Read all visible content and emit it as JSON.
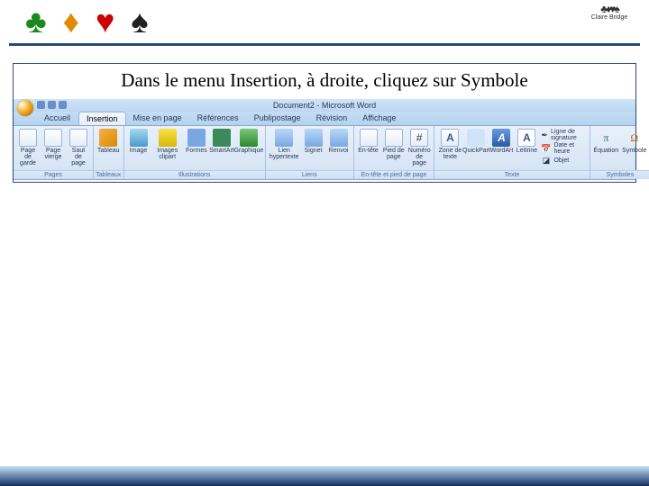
{
  "brand": {
    "suits": [
      "♣",
      "♦",
      "♥",
      "♠"
    ],
    "logo_suits": "♣♦♥♠",
    "logo_text": "Claire Bridge"
  },
  "instruction": "Dans le menu Insertion, à droite, cliquez sur Symbole",
  "word": {
    "title": "Document2 - Microsoft Word",
    "tabs": [
      "Accueil",
      "Insertion",
      "Mise en page",
      "Références",
      "Publipostage",
      "Révision",
      "Affichage"
    ],
    "active_tab_index": 1,
    "groups": {
      "pages": {
        "label": "Pages",
        "cover": "Page de garde",
        "blank": "Page vierge",
        "break": "Saut de page"
      },
      "tables": {
        "label": "Tableaux",
        "table": "Tableau"
      },
      "illustrations": {
        "label": "Illustrations",
        "image": "Image",
        "clipart": "Images clipart",
        "shapes": "Formes",
        "smartart": "SmartArt",
        "chart": "Graphique"
      },
      "links": {
        "label": "Liens",
        "hyperlink": "Lien hypertexte",
        "bookmark": "Signet",
        "crossref": "Renvoi"
      },
      "headerfooter": {
        "label": "En-tête et pied de page",
        "header": "En-tête",
        "footer": "Pied de page",
        "pagenum": "Numéro de page"
      },
      "text": {
        "label": "Texte",
        "textbox": "Zone de texte",
        "quickpart": "QuickPart",
        "wordart": "WordArt",
        "dropcap": "Lettrine",
        "sigline": "Ligne de signature",
        "datetime": "Date et heure",
        "object": "Objet"
      },
      "symbols": {
        "label": "Symboles",
        "equation": "Équation",
        "symbol": "Symbole"
      }
    }
  }
}
